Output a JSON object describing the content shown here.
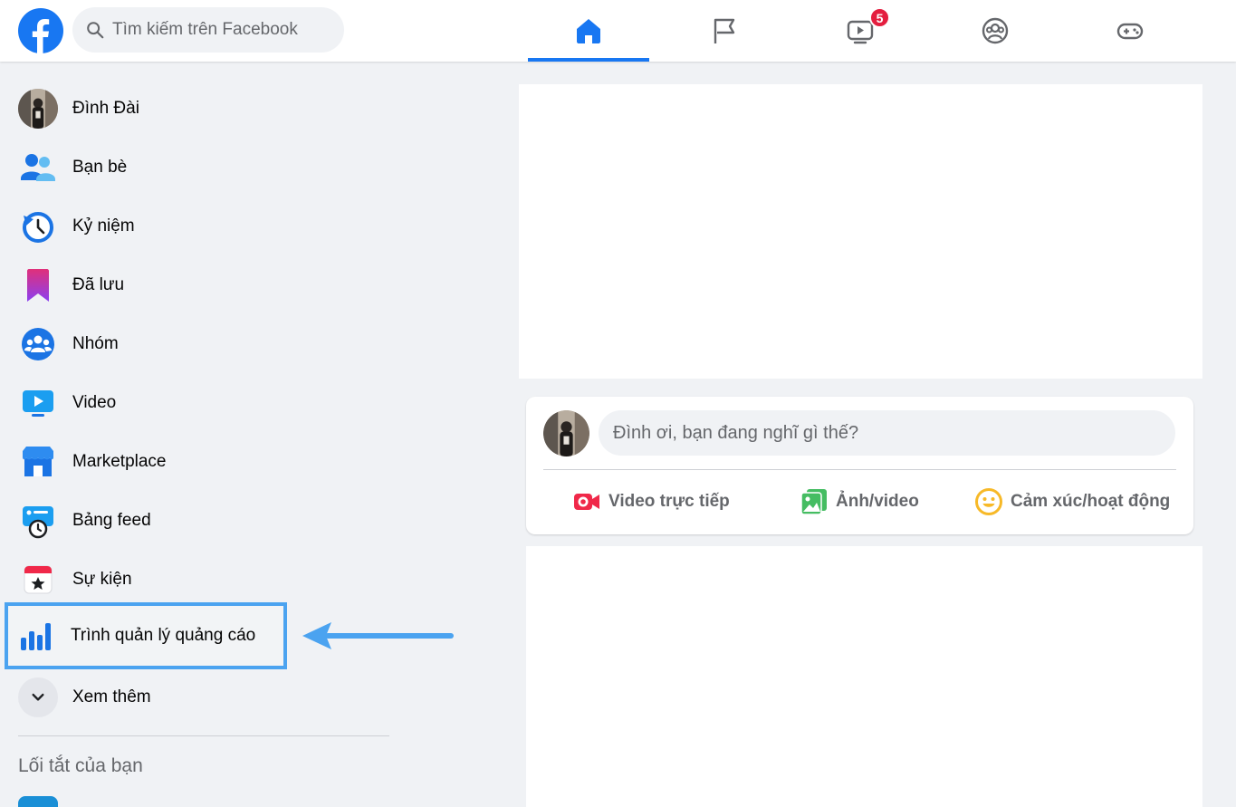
{
  "colors": {
    "brand": "#1877f2",
    "badge": "#e41e3f",
    "highlight": "#4ba3f0",
    "text_secondary": "#65676b"
  },
  "header": {
    "logo_icon": "facebook-logo",
    "search": {
      "placeholder": "Tìm kiếm trên Facebook",
      "icon": "search-icon"
    },
    "nav_tabs": [
      {
        "icon": "home-icon",
        "active": true
      },
      {
        "icon": "flag-icon",
        "active": false
      },
      {
        "icon": "watch-icon",
        "active": false,
        "badge": "5"
      },
      {
        "icon": "groups-icon",
        "active": false
      },
      {
        "icon": "gaming-icon",
        "active": false
      }
    ]
  },
  "sidebar": {
    "items": [
      {
        "label": "Đình Đài",
        "icon": "profile-avatar"
      },
      {
        "label": "Bạn bè",
        "icon": "friends-icon"
      },
      {
        "label": "Kỷ niệm",
        "icon": "memories-icon"
      },
      {
        "label": "Đã lưu",
        "icon": "saved-icon"
      },
      {
        "label": "Nhóm",
        "icon": "groups-icon"
      },
      {
        "label": "Video",
        "icon": "video-icon"
      },
      {
        "label": "Marketplace",
        "icon": "marketplace-icon"
      },
      {
        "label": "Bảng feed",
        "icon": "feeds-icon"
      },
      {
        "label": "Sự kiện",
        "icon": "events-icon"
      },
      {
        "label": "Trình quản lý quảng cáo",
        "icon": "ads-manager-icon",
        "highlighted": true
      },
      {
        "label": "Xem thêm",
        "icon": "chevron-down-icon"
      }
    ],
    "shortcuts_title": "Lối tắt của bạn"
  },
  "composer": {
    "placeholder": "Đình ơi, bạn đang nghĩ gì thế?",
    "actions": [
      {
        "label": "Video trực tiếp",
        "icon": "live-video-icon"
      },
      {
        "label": "Ảnh/video",
        "icon": "photo-icon"
      },
      {
        "label": "Cảm xúc/hoạt động",
        "icon": "feeling-icon"
      }
    ]
  }
}
